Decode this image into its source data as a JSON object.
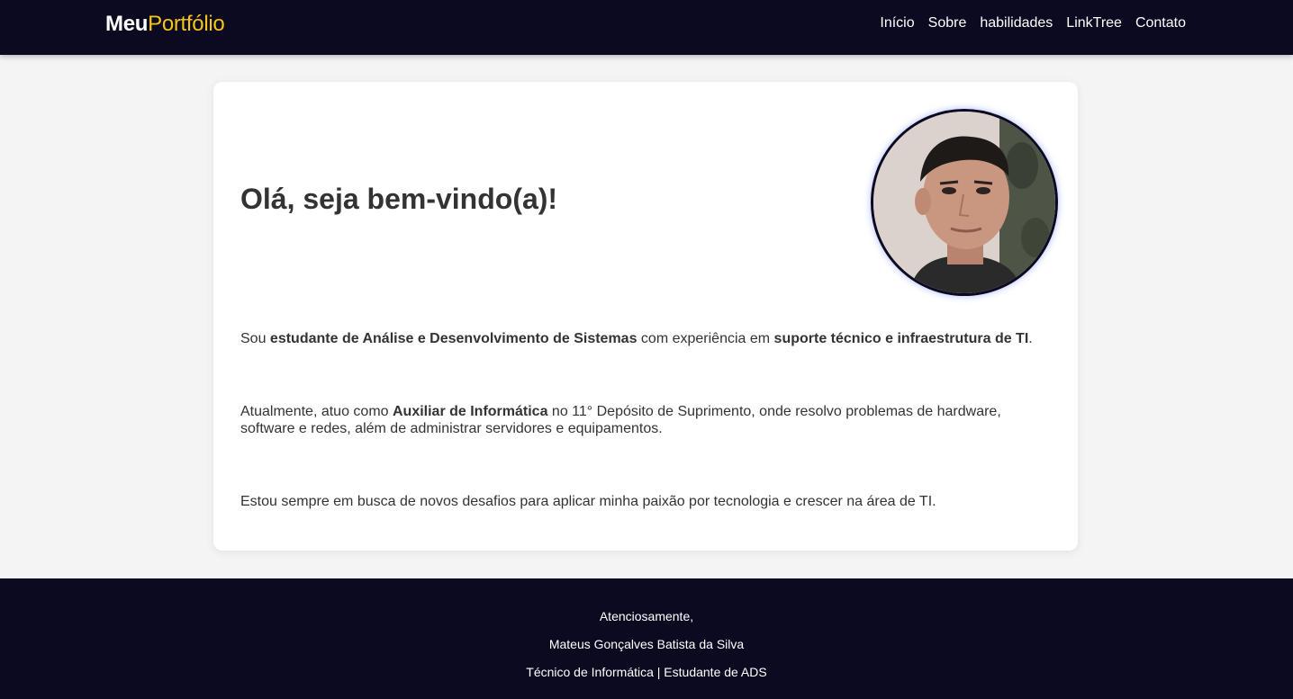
{
  "header": {
    "brand_first": "Meu",
    "brand_second": "Portfólio",
    "nav": [
      {
        "label": "Início"
      },
      {
        "label": "Sobre"
      },
      {
        "label": "habilidades"
      },
      {
        "label": "LinkTree"
      },
      {
        "label": "Contato"
      }
    ]
  },
  "main": {
    "greeting": "Olá, seja bem-vindo(a)!",
    "paragraph1": {
      "t1": "Sou ",
      "b1": "estudante de Análise e Desenvolvimento de Sistemas",
      "t2": " com experiência em ",
      "b2": "suporte técnico e infraestrutura de TI",
      "t3": "."
    },
    "paragraph2": {
      "t1": "Atualmente, atuo como ",
      "b1": "Auxiliar de Informática",
      "t2": " no 11° Depósito de Suprimento, onde resolvo problemas de hardware, software e redes, além de administrar servidores e equipamentos."
    },
    "paragraph3": "Estou sempre em busca de novos desafios para aplicar minha paixão por tecnologia e crescer na área de TI."
  },
  "footer": {
    "line1": "Atenciosamente,",
    "line2": "Mateus Gonçalves Batista da Silva",
    "line3": "Técnico de Informática | Estudante de ADS"
  },
  "colors": {
    "navy": "#0b0a21",
    "accent": "#f5c518",
    "background": "#f4f4f4",
    "card": "#ffffff",
    "text": "#333333"
  }
}
